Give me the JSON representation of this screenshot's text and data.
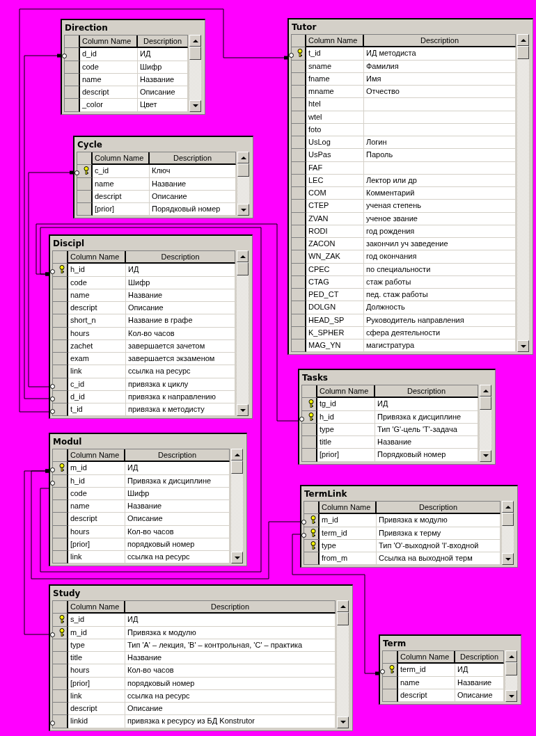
{
  "tables": [
    {
      "title": "Direction",
      "columns": [
        "Column Name",
        "Description"
      ],
      "rows": [
        {
          "name": "d_id",
          "description": "ИД",
          "key": false,
          "fk": true
        },
        {
          "name": "code",
          "description": "Шифр",
          "key": false,
          "fk": false
        },
        {
          "name": "name",
          "description": "Название",
          "key": false,
          "fk": false
        },
        {
          "name": "descript",
          "description": "Описание",
          "key": false,
          "fk": false
        },
        {
          "name": "_color",
          "description": "Цвет",
          "key": false,
          "fk": false
        }
      ]
    },
    {
      "title": "Cycle",
      "columns": [
        "Column Name",
        "Description"
      ],
      "rows": [
        {
          "name": "c_id",
          "description": "Ключ",
          "key": true,
          "fk": true
        },
        {
          "name": "name",
          "description": "Название",
          "key": false,
          "fk": false
        },
        {
          "name": "descript",
          "description": "Описание",
          "key": false,
          "fk": false
        },
        {
          "name": "[prior]",
          "description": "Порядковый номер",
          "key": false,
          "fk": false
        }
      ]
    },
    {
      "title": "Discipl",
      "columns": [
        "Column Name",
        "Description"
      ],
      "rows": [
        {
          "name": "h_id",
          "description": "ИД",
          "key": true,
          "fk": true
        },
        {
          "name": "code",
          "description": "Шифр",
          "key": false,
          "fk": false
        },
        {
          "name": "name",
          "description": "Название",
          "key": false,
          "fk": false
        },
        {
          "name": "descript",
          "description": "Описание",
          "key": false,
          "fk": false
        },
        {
          "name": "short_n",
          "description": "Название в графе",
          "key": false,
          "fk": false
        },
        {
          "name": "hours",
          "description": "Кол-во часов",
          "key": false,
          "fk": false
        },
        {
          "name": "zachet",
          "description": "завершается зачетом",
          "key": false,
          "fk": false
        },
        {
          "name": "exam",
          "description": "завершается экзаменом",
          "key": false,
          "fk": false
        },
        {
          "name": "link",
          "description": "ссылка на ресурс",
          "key": false,
          "fk": false
        },
        {
          "name": "c_id",
          "description": "привязка к циклу",
          "key": false,
          "fk": true
        },
        {
          "name": "d_id",
          "description": "привязка к направлению",
          "key": false,
          "fk": true
        },
        {
          "name": "t_id",
          "description": "привязка к методисту",
          "key": false,
          "fk": true
        }
      ]
    },
    {
      "title": "Modul",
      "columns": [
        "Column Name",
        "Description"
      ],
      "rows": [
        {
          "name": "m_id",
          "description": "ИД",
          "key": true,
          "fk": true
        },
        {
          "name": "h_id",
          "description": "Привязка к дисциплине",
          "key": false,
          "fk": true
        },
        {
          "name": "code",
          "description": "Шифр",
          "key": false,
          "fk": false
        },
        {
          "name": "name",
          "description": "Название",
          "key": false,
          "fk": false
        },
        {
          "name": "descript",
          "description": "Описание",
          "key": false,
          "fk": false
        },
        {
          "name": "hours",
          "description": "Кол-во часов",
          "key": false,
          "fk": false
        },
        {
          "name": "[prior]",
          "description": "порядковый номер",
          "key": false,
          "fk": false
        },
        {
          "name": "link",
          "description": "ссылка на ресурс",
          "key": false,
          "fk": false
        }
      ]
    },
    {
      "title": "Study",
      "columns": [
        "Column Name",
        "Description"
      ],
      "rows": [
        {
          "name": "s_id",
          "description": "ИД",
          "key": true,
          "fk": false
        },
        {
          "name": "m_id",
          "description": "Привязка к модулю",
          "key": true,
          "fk": true
        },
        {
          "name": "type",
          "description": "Тип 'А' – лекция,  'В' – контрольная, 'С' – практика",
          "key": false,
          "fk": false
        },
        {
          "name": "title",
          "description": "Название",
          "key": false,
          "fk": false
        },
        {
          "name": "hours",
          "description": "Кол-во часов",
          "key": false,
          "fk": false
        },
        {
          "name": "[prior]",
          "description": "порядковый номер",
          "key": false,
          "fk": false
        },
        {
          "name": "link",
          "description": "ссылка на ресурс",
          "key": false,
          "fk": false
        },
        {
          "name": "descript",
          "description": "Описание",
          "key": false,
          "fk": false
        },
        {
          "name": "linkid",
          "description": "привязка к ресурсу из БД Konstrutor",
          "key": false,
          "fk": true
        }
      ]
    },
    {
      "title": "Tutor",
      "columns": [
        "Column Name",
        "Description"
      ],
      "rows": [
        {
          "name": "t_id",
          "description": "ИД методиста",
          "key": true,
          "fk": true
        },
        {
          "name": "sname",
          "description": "Фамилия",
          "key": false,
          "fk": false
        },
        {
          "name": "fname",
          "description": "Имя",
          "key": false,
          "fk": false
        },
        {
          "name": "mname",
          "description": "Отчество",
          "key": false,
          "fk": false
        },
        {
          "name": "htel",
          "key": false,
          "fk": false
        },
        {
          "name": "wtel",
          "key": false,
          "fk": false
        },
        {
          "name": "foto",
          "key": false,
          "fk": false
        },
        {
          "name": "UsLog",
          "description": "Логин",
          "key": false,
          "fk": false
        },
        {
          "name": "UsPas",
          "description": "Пароль",
          "key": false,
          "fk": false
        },
        {
          "name": "FAF",
          "key": false,
          "fk": false
        },
        {
          "name": "LEC",
          "description": "Лектор или др",
          "key": false,
          "fk": false
        },
        {
          "name": "COM",
          "description": "Комментарий",
          "key": false,
          "fk": false
        },
        {
          "name": "CTEP",
          "description": "ученая степень",
          "key": false,
          "fk": false
        },
        {
          "name": "ZVAN",
          "description": "ученое звание",
          "key": false,
          "fk": false
        },
        {
          "name": "RODI",
          "description": "год рождения",
          "key": false,
          "fk": false
        },
        {
          "name": "ZACON",
          "description": "закончил уч заведение",
          "key": false,
          "fk": false
        },
        {
          "name": "WN_ZAK",
          "description": "год окончания",
          "key": false,
          "fk": false
        },
        {
          "name": "CPEC",
          "description": "по специальности",
          "key": false,
          "fk": false
        },
        {
          "name": "CTAG",
          "description": "стаж работы",
          "key": false,
          "fk": false
        },
        {
          "name": "PED_CT",
          "description": "пед. стаж работы",
          "key": false,
          "fk": false
        },
        {
          "name": "DOLGN",
          "description": "Должность",
          "key": false,
          "fk": false
        },
        {
          "name": "HEAD_SP",
          "description": "Руководитель направления",
          "key": false,
          "fk": false
        },
        {
          "name": "K_SPHER",
          "description": "сфера деятельности",
          "key": false,
          "fk": false
        },
        {
          "name": "MAG_YN",
          "description": "магистратура",
          "key": false,
          "fk": false
        }
      ]
    },
    {
      "title": "Tasks",
      "columns": [
        "Column Name",
        "Description"
      ],
      "rows": [
        {
          "name": "tg_id",
          "description": "ИД",
          "key": true,
          "fk": false
        },
        {
          "name": "h_id",
          "description": "Привязка к дисциплине",
          "key": true,
          "fk": true
        },
        {
          "name": "type",
          "description": "Тип 'G'-цель 'T'-задача",
          "key": false,
          "fk": false
        },
        {
          "name": "title",
          "description": "Название",
          "key": false,
          "fk": false
        },
        {
          "name": "[prior]",
          "description": "Порядковый номер",
          "key": false,
          "fk": false
        }
      ]
    },
    {
      "title": "TermLink",
      "columns": [
        "Column Name",
        "Description"
      ],
      "rows": [
        {
          "name": "m_id",
          "description": "Привязка к модулю",
          "key": true,
          "fk": true
        },
        {
          "name": "term_id",
          "description": "Привязка к терму",
          "key": true,
          "fk": true
        },
        {
          "name": "type",
          "description": "Тип 'O'-выходной 'I'-входной",
          "key": true,
          "fk": false
        },
        {
          "name": "from_m",
          "description": "Ссылка на выходной терм",
          "key": false,
          "fk": false
        }
      ]
    },
    {
      "title": "Term",
      "columns": [
        "Column Name",
        "Description"
      ],
      "rows": [
        {
          "name": "term_id",
          "description": "ИД",
          "key": true,
          "fk": true
        },
        {
          "name": "name",
          "description": "Название",
          "key": false,
          "fk": false
        },
        {
          "name": "descript",
          "description": "Описание",
          "key": false,
          "fk": false
        }
      ]
    }
  ]
}
